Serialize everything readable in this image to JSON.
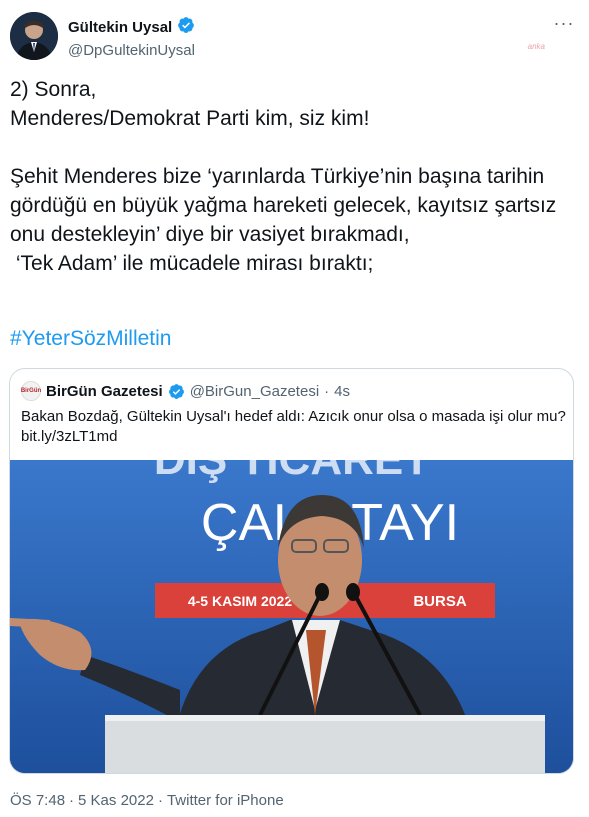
{
  "author": {
    "display_name": "Gültekin Uysal",
    "handle": "@DpGultekinUysal",
    "verified_icon": "verified-badge-icon"
  },
  "watermark": "anka",
  "tweet": {
    "paragraphs": [
      "2) Sonra,\nMenderes/Demokrat Parti kim, siz kim!",
      "Şehit Menderes bize ‘yarınlarda Türkiye’nin başına tarihin gördüğü en büyük yağma hareketi gelecek, kayıtsız şartsız onu destekleyin’ diye bir vasiyet bırakmadı,\n ‘Tek Adam’ ile mücadele mirası bıraktı;"
    ],
    "hashtag": "#YeterSözMilletin"
  },
  "quoted_tweet": {
    "avatar_text": "BirGün",
    "display_name": "BirGün Gazetesi",
    "handle": "@BirGun_Gazetesi",
    "separator": "·",
    "time": "4s",
    "text": "Bakan Bozdağ, Gültekin Uysal'ı hedef aldı: Azıcık onur olsa o masada işi olur mu?",
    "link": "bit.ly/3zLT1md",
    "image": {
      "banner_text": "ÇALIŞTAYI",
      "banner_top_text": "DIŞ TİCARET",
      "date_text": "4-5 KASIM 2022",
      "city_text": "BURSA"
    }
  },
  "meta": {
    "time": "ÖS 7:48",
    "sep1": "·",
    "date": "5 Kas 2022",
    "sep2": "·",
    "source": "Twitter for iPhone"
  },
  "colors": {
    "link": "#1d9bf0",
    "verified": "#1d9bf0",
    "secondary_text": "#536471",
    "banner_blue": "#2a64b8",
    "banner_red": "#d9413a"
  }
}
